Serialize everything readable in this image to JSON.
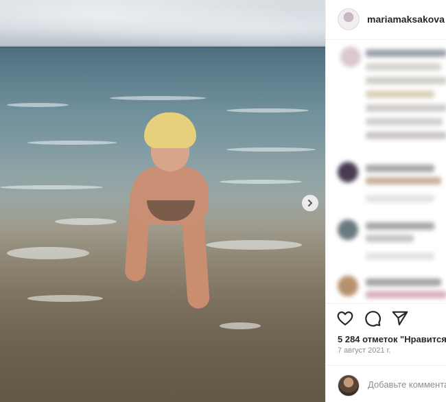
{
  "post": {
    "username": "mariamaksakova",
    "verified_badge": "✓",
    "likes_text": "5 284 отметок \"Нравится\"",
    "date_text": "7 август 2021 г.",
    "comment_placeholder": "Добавьте комментарий..."
  },
  "icons": {
    "next": "chevron-right-icon",
    "like": "heart-icon",
    "comment": "comment-icon",
    "share": "paper-plane-icon"
  },
  "colors": {
    "verified": "#3897f0",
    "text": "#262626",
    "muted": "#8e8e8e",
    "border": "#efefef"
  }
}
